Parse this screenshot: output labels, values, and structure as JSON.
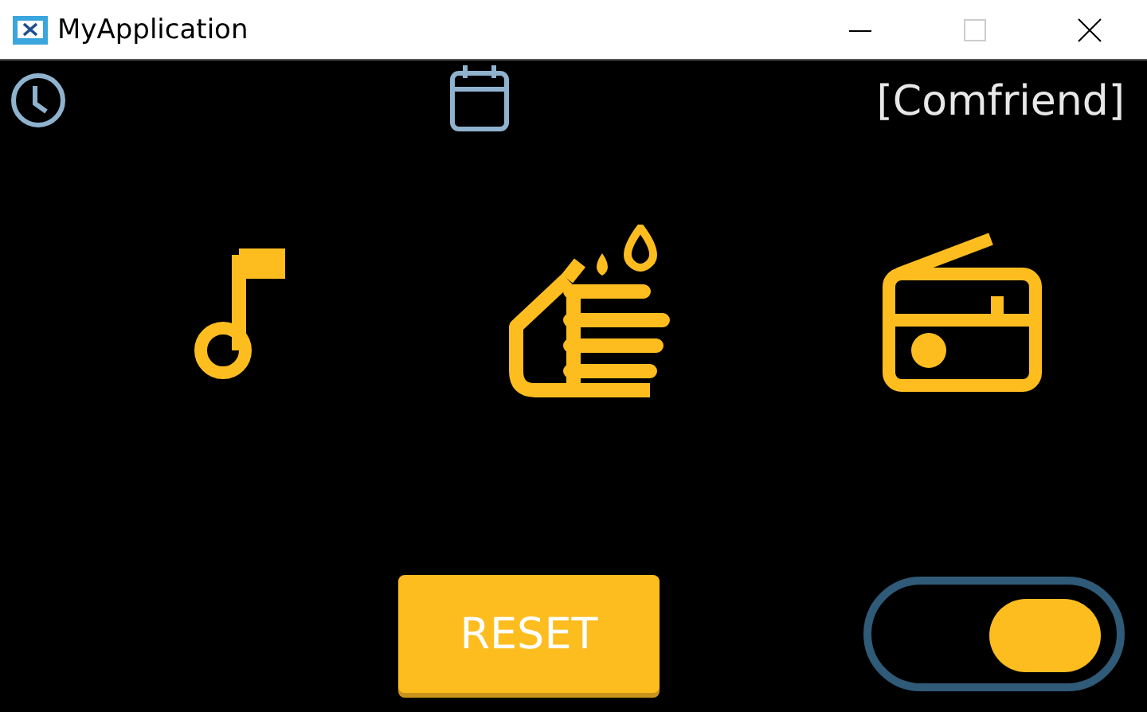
{
  "window": {
    "title": "MyApplication"
  },
  "header": {
    "label": "[Comfriend]"
  },
  "reset_button": {
    "label": "RESET"
  },
  "toggle": {
    "on": true
  }
}
